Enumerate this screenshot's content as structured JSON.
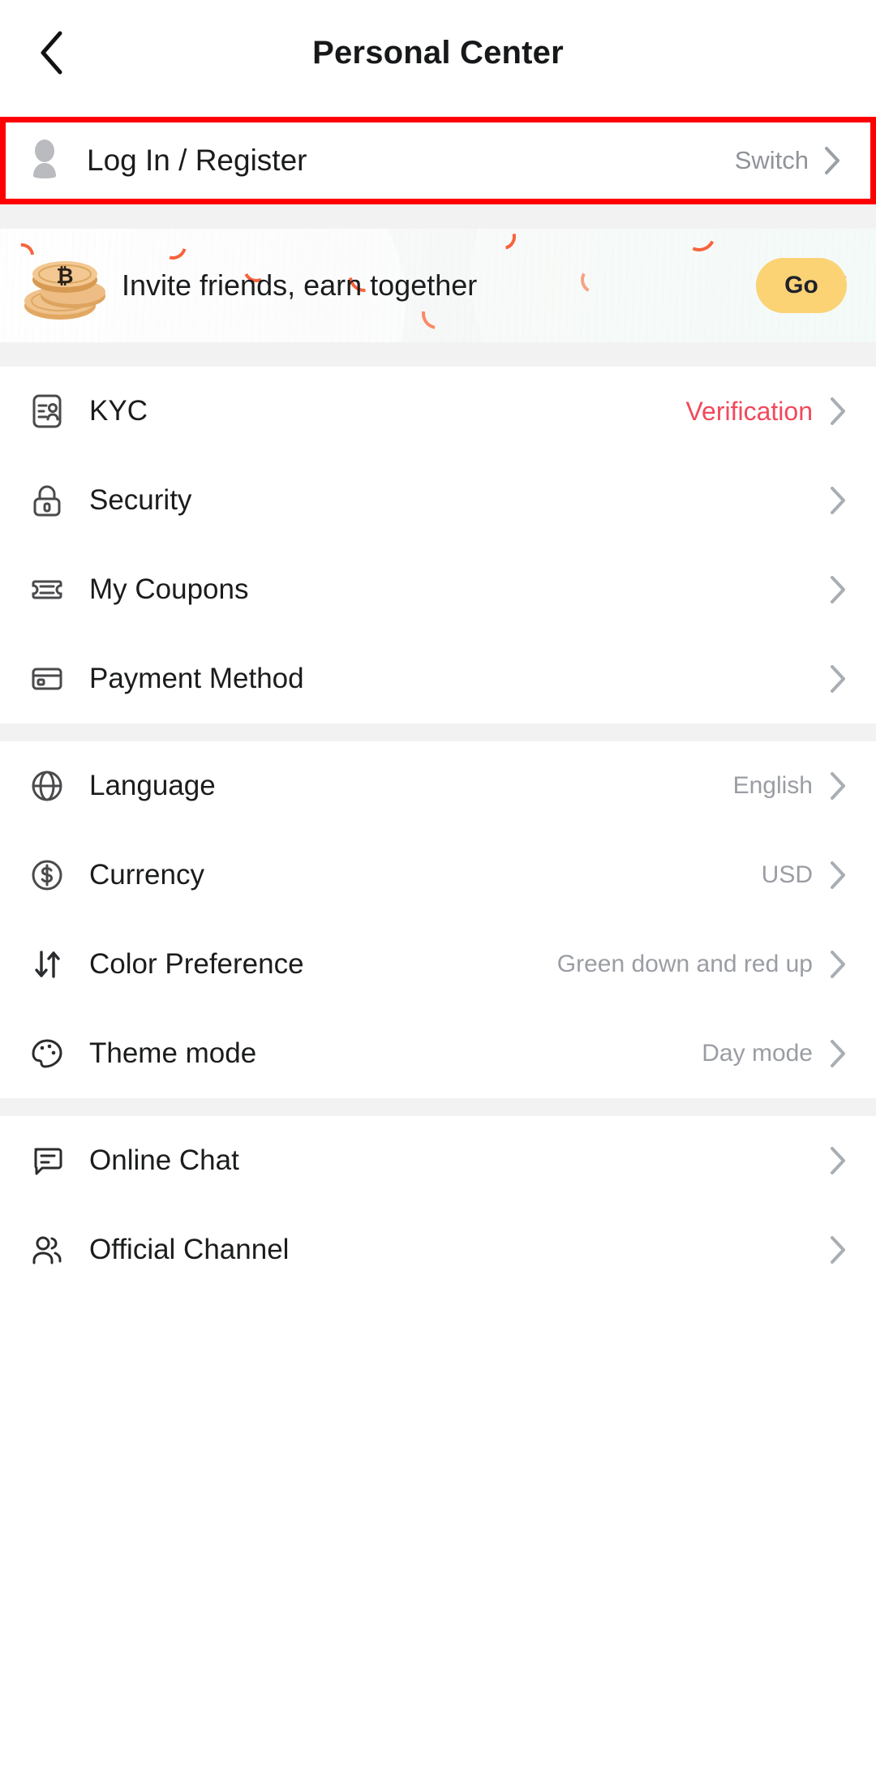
{
  "header": {
    "title": "Personal Center",
    "back_icon": "chevron-left-icon"
  },
  "account": {
    "avatar_icon": "user-avatar-icon",
    "label": "Log In / Register",
    "action_label": "Switch",
    "chevron_icon": "chevron-right-icon",
    "highlight_color": "#ff0000"
  },
  "invite_banner": {
    "icon": "bitcoin-coins-icon",
    "text": "Invite friends, earn together",
    "button_label": "Go",
    "button_color": "#fbd375"
  },
  "sections": [
    {
      "name": "account-section",
      "rows": [
        {
          "icon": "id-card-icon",
          "label": "KYC",
          "value": "Verification",
          "value_style": "accent"
        },
        {
          "icon": "lock-icon",
          "label": "Security",
          "value": "",
          "value_style": "muted"
        },
        {
          "icon": "coupon-ticket-icon",
          "label": "My Coupons",
          "value": "",
          "value_style": "muted"
        },
        {
          "icon": "credit-card-icon",
          "label": "Payment Method",
          "value": "",
          "value_style": "muted"
        }
      ]
    },
    {
      "name": "preferences-section",
      "rows": [
        {
          "icon": "globe-icon",
          "label": "Language",
          "value": "English",
          "value_style": "muted"
        },
        {
          "icon": "dollar-circle-icon",
          "label": "Currency",
          "value": "USD",
          "value_style": "muted"
        },
        {
          "icon": "updown-arrows-icon",
          "label": "Color Preference",
          "value": "Green down and red up",
          "value_style": "muted"
        },
        {
          "icon": "palette-icon",
          "label": "Theme mode",
          "value": "Day mode",
          "value_style": "muted"
        }
      ]
    },
    {
      "name": "support-section",
      "rows": [
        {
          "icon": "chat-bubble-icon",
          "label": "Online Chat",
          "value": "",
          "value_style": "muted"
        },
        {
          "icon": "people-group-icon",
          "label": "Official Channel",
          "value": "",
          "value_style": "muted"
        }
      ]
    }
  ],
  "colors": {
    "accent_red": "#f1495c",
    "muted_text": "#9a9da3",
    "primary_text": "#1b1c1e",
    "divider_gray": "#f2f2f2",
    "highlight": "#ff0000",
    "go_button": "#fbd375"
  }
}
